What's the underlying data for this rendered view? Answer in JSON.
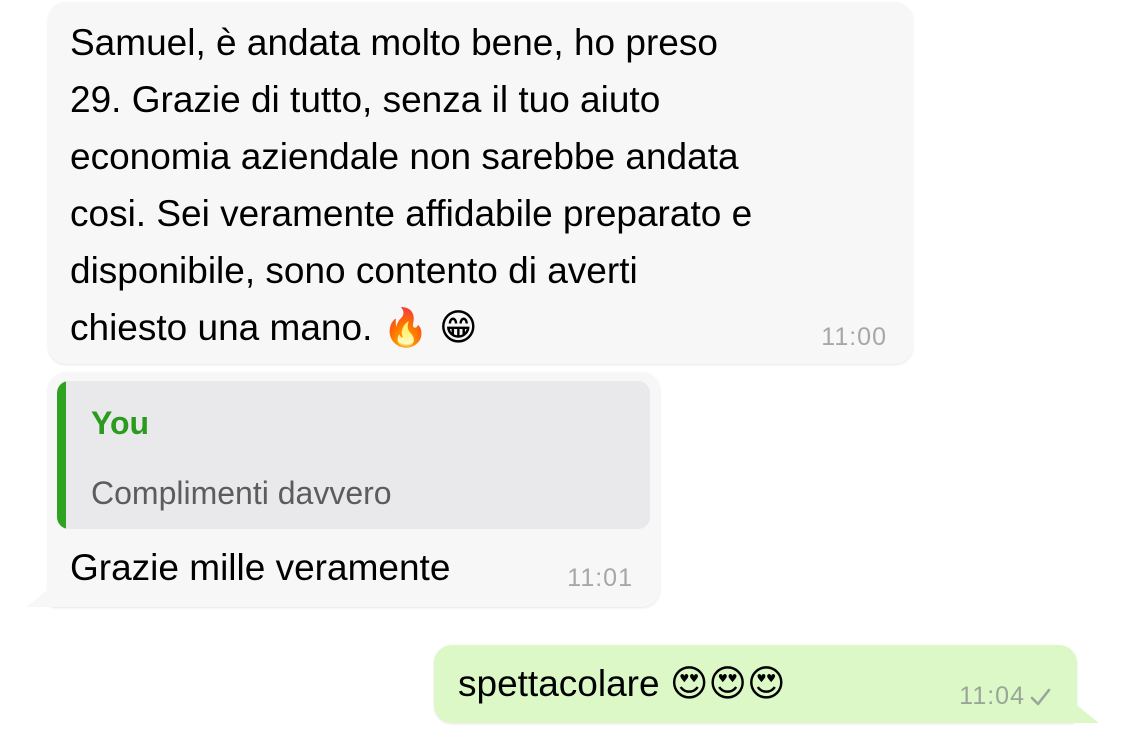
{
  "messages": [
    {
      "direction": "incoming",
      "text": "Samuel, è andata molto bene, ho preso\n29. Grazie di tutto, senza il tuo aiuto\neconomia aziendale non sarebbe andata\ncosi. Sei veramente affidabile preparato e\ndisponibile, sono contento di averti\nchiesto una mano. 🔥 😁",
      "time": "11:00"
    },
    {
      "direction": "incoming",
      "quote": {
        "author": "You",
        "text": "Complimenti davvero"
      },
      "text": "Grazie mille veramente",
      "time": "11:01"
    },
    {
      "direction": "outgoing",
      "text": "spettacolare 😍😍😍",
      "time": "11:04",
      "status_icon": "single-check-icon"
    }
  ],
  "colors": {
    "incoming_bubble": "#f7f7f7",
    "outgoing_bubble": "#dcf8c6",
    "quote_accent": "#2fa321",
    "timestamp": "#a7a7a7"
  }
}
